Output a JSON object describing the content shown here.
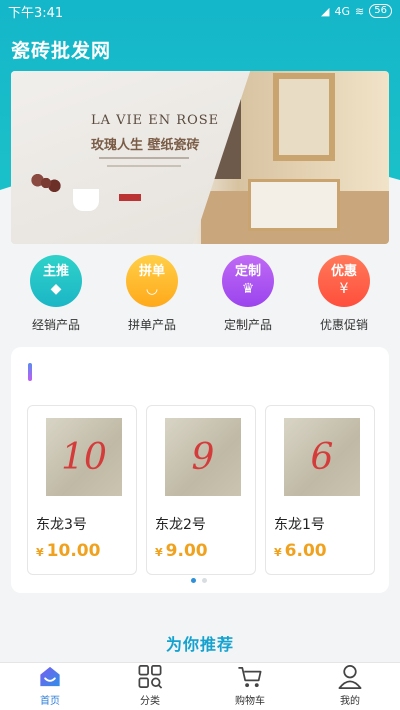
{
  "status": {
    "time": "下午3:41",
    "network": "4G",
    "battery": "56"
  },
  "app": {
    "title": "瓷砖批发网"
  },
  "banner": {
    "headline_en": "LA VIE EN ROSE",
    "headline_cn": "玫瑰人生 壁纸瓷砖"
  },
  "categories": [
    {
      "badge": "主推",
      "label": "经销产品",
      "color_start": "#2fd2c9",
      "color_end": "#1bb6c6",
      "icon": "diamond-icon"
    },
    {
      "badge": "拼单",
      "label": "拼单产品",
      "color_start": "#ffcf48",
      "color_end": "#ffa91a",
      "icon": "smile-icon"
    },
    {
      "badge": "定制",
      "label": "定制产品",
      "color_start": "#c06af5",
      "color_end": "#9b44ee",
      "icon": "crown-icon"
    },
    {
      "badge": "优惠",
      "label": "优惠促销",
      "color_start": "#ff7a5a",
      "color_end": "#ff4e3c",
      "icon": "coupon-icon"
    }
  ],
  "products": [
    {
      "name": "东龙3号",
      "price": "10.00",
      "currency": "¥",
      "tile_number": "10"
    },
    {
      "name": "东龙2号",
      "price": "9.00",
      "currency": "¥",
      "tile_number": "9"
    },
    {
      "name": "东龙1号",
      "price": "6.00",
      "currency": "¥",
      "tile_number": "6"
    }
  ],
  "carousel": {
    "pages": 2,
    "active": 0
  },
  "recommend": {
    "title": "为你推荐"
  },
  "tabbar": [
    {
      "label": "首页",
      "icon": "home-icon",
      "active": true
    },
    {
      "label": "分类",
      "icon": "category-icon",
      "active": false
    },
    {
      "label": "购物车",
      "icon": "cart-icon",
      "active": false
    },
    {
      "label": "我的",
      "icon": "user-icon",
      "active": false
    }
  ],
  "colors": {
    "brand": "#14b6c9",
    "price": "#f0a21f",
    "tab_active": "#2f7fd8"
  }
}
